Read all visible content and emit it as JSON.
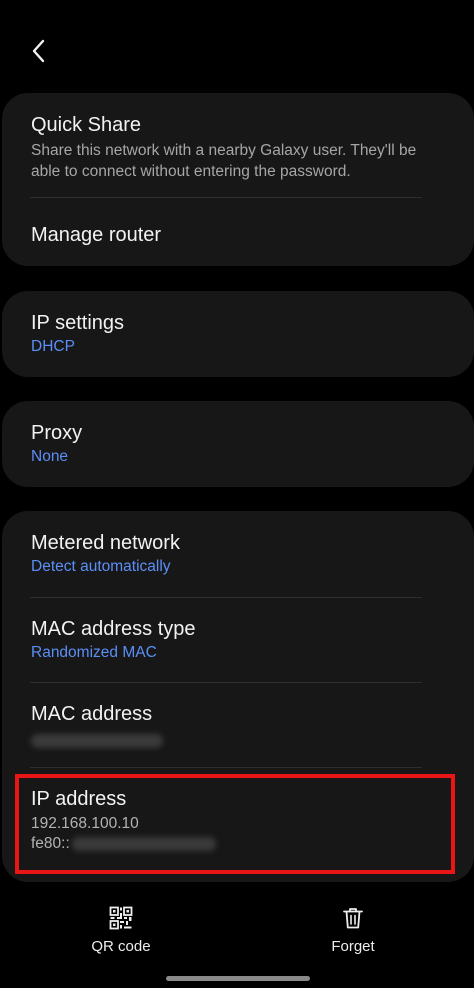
{
  "nav": {
    "back_icon": "chevron-left-icon"
  },
  "sections": {
    "quick_share": {
      "title": "Quick Share",
      "description": "Share this network with a nearby Galaxy user. They'll be able to connect without entering the password."
    },
    "manage_router": {
      "title": "Manage router"
    },
    "ip_settings": {
      "title": "IP settings",
      "value": "DHCP"
    },
    "proxy": {
      "title": "Proxy",
      "value": "None"
    },
    "metered_network": {
      "title": "Metered network",
      "value": "Detect automatically"
    },
    "mac_address_type": {
      "title": "MAC address type",
      "value": "Randomized MAC"
    },
    "mac_address": {
      "title": "MAC address"
    },
    "ip_address": {
      "title": "IP address",
      "ipv4": "192.168.100.10",
      "ipv6_prefix": "fe80::"
    }
  },
  "bottom_bar": {
    "qr_code": {
      "label": "QR code",
      "icon": "qr-code-icon"
    },
    "forget": {
      "label": "Forget",
      "icon": "trash-icon"
    }
  },
  "colors": {
    "background": "#000000",
    "card": "#171717",
    "accent_blue": "#5b8ff7",
    "highlight_red": "#ea1616"
  }
}
